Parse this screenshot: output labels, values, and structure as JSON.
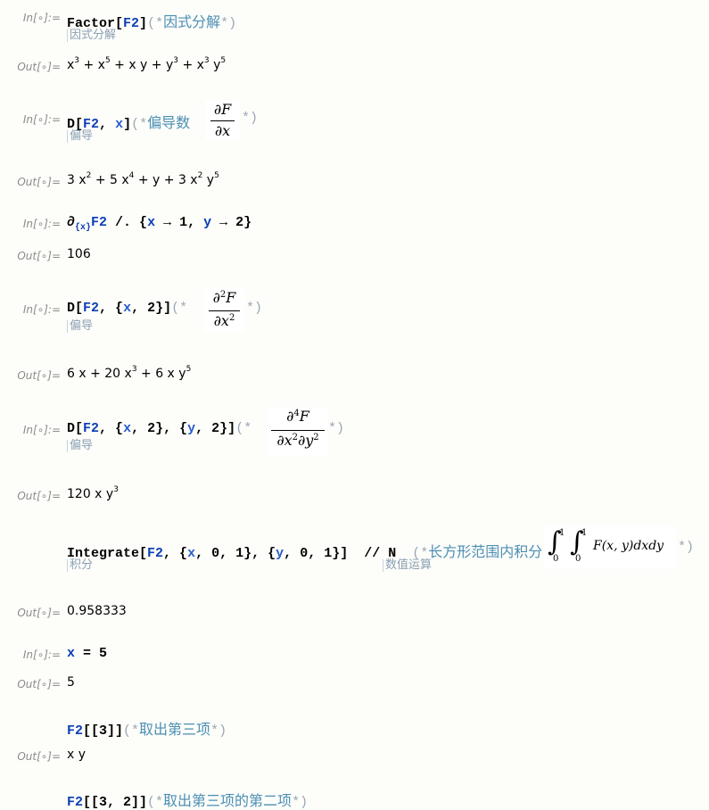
{
  "cells": {
    "in1": {
      "label": "In[∘]:=",
      "head": "Factor",
      "arg": "F2",
      "comment": "因式分解",
      "tip": "因式分解"
    },
    "out1": {
      "label": "Out[∘]=",
      "t1": "x",
      "e1": "3",
      "t2": " + x",
      "e2": "5",
      "t3": " + x y + y",
      "e3": "3",
      "t4": " + x",
      "e4": "3",
      "t5": " y",
      "e5": "5"
    },
    "in2": {
      "label": "In[∘]:=",
      "head": "D",
      "arg": "F2",
      "var": "x",
      "comment": "偏导数",
      "tip": "偏导"
    },
    "out2": {
      "label": "Out[∘]=",
      "t1": "3 x",
      "e1": "2",
      "t2": " + 5 x",
      "e2": "4",
      "t3": " + y + 3 x",
      "e3": "2",
      "t4": " y",
      "e4": "5"
    },
    "in3": {
      "label": "In[∘]:=",
      "partial": "∂",
      "sub": "{x}",
      "arg": "F2",
      "rule": " /. {",
      "x": "x",
      "arrow": " → ",
      "xv": "1",
      "comma": ", ",
      "y": "y",
      "yv": "2",
      "close": "}"
    },
    "out3": {
      "label": "Out[∘]=",
      "value": "106"
    },
    "in4": {
      "label": "In[∘]:=",
      "head": "D",
      "arg": "F2",
      "var": "x",
      "n": "2",
      "tip": "偏导"
    },
    "out4": {
      "label": "Out[∘]=",
      "t1": "6 x + 20 x",
      "e1": "3",
      "t2": " + 6 x y",
      "e2": "5"
    },
    "in5": {
      "label": "In[∘]:=",
      "head": "D",
      "arg": "F2",
      "var1": "x",
      "n1": "2",
      "var2": "y",
      "n2": "2",
      "tip": "偏导"
    },
    "out5": {
      "label": "Out[∘]=",
      "t1": "120 x y",
      "e1": "3"
    },
    "in6": {
      "head": "Integrate",
      "arg": "F2",
      "x": "x",
      "y": "y",
      "lo": "0",
      "hi": "1",
      "post": "// N",
      "comment": "长方形范围内积分",
      "tip1": "积分",
      "tip2": "数值运算"
    },
    "out6": {
      "label": "Out[∘]=",
      "value": "0.958333"
    },
    "in7": {
      "label": "In[∘]:=",
      "var": "x",
      "eq": " = ",
      "val": "5"
    },
    "out7": {
      "label": "Out[∘]=",
      "value": "5"
    },
    "in8": {
      "arg": "F2",
      "idx": "[[3]]",
      "comment": "取出第三项"
    },
    "out8": {
      "label": "Out[∘]=",
      "value": "x y"
    },
    "in9": {
      "arg": "F2",
      "idx": "[[3, 2]]",
      "comment": "取出第三项的第二项"
    }
  },
  "math": {
    "df_num": "∂F",
    "df_den": "∂x",
    "d2_num": "∂",
    "d2_num_exp": "2",
    "d2_num_f": "F",
    "d2_den": "∂x",
    "d2_den_exp": "2",
    "d4_num": "∂",
    "d4_num_exp": "4",
    "d4_num_f": "F",
    "d4_den_a": "∂x",
    "d4_den_a_exp": "2",
    "d4_den_b": "∂y",
    "d4_den_b_exp": "2",
    "int_sym": "∫",
    "int_lo": "0",
    "int_hi": "1",
    "int_body": "F(x, y)dxdy"
  },
  "comment_open": "(*",
  "comment_close": "*)"
}
